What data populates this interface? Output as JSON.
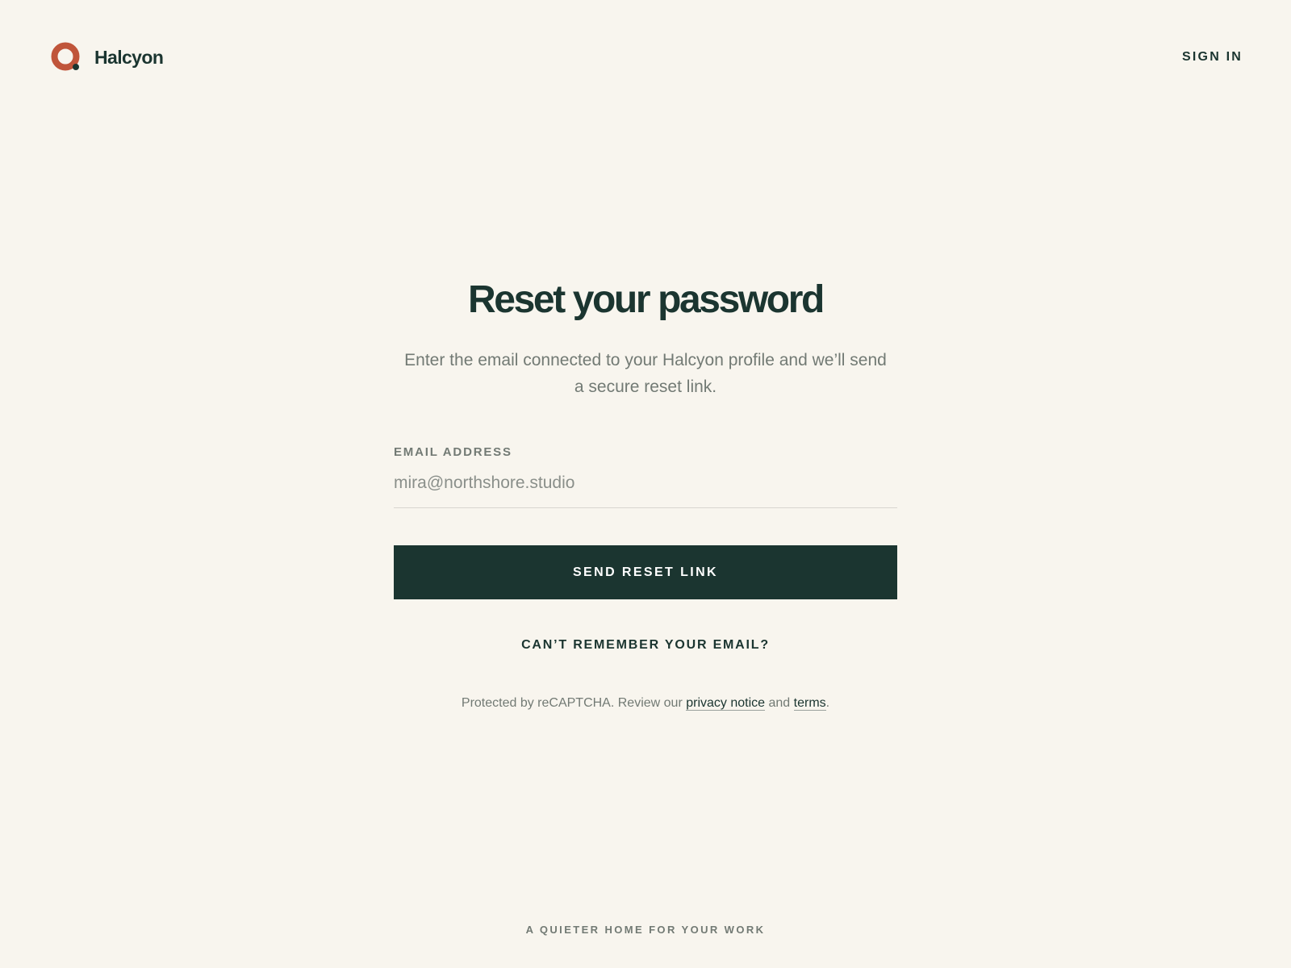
{
  "brand": {
    "name": "Halcyon",
    "logo_icon": "halcyon-ring-logo",
    "logo_color": "#c0553a",
    "logo_dot_color": "#1b3530"
  },
  "header": {
    "signin_label": "SIGN IN"
  },
  "main": {
    "title": "Reset your password",
    "subtitle": "Enter the email connected to your Halcyon profile and we’ll send a secure reset link.",
    "email_label": "EMAIL ADDRESS",
    "email_placeholder": "mira@northshore.studio",
    "email_value": "",
    "submit_label": "SEND RESET LINK",
    "forgot_email_label": "CAN’T REMEMBER YOUR EMAIL?"
  },
  "legal": {
    "prefix": "Protected by reCAPTCHA. Review our",
    "privacy_label": "privacy notice",
    "and_text": "and",
    "terms_label": "terms",
    "suffix": "."
  },
  "footer": {
    "tagline": "A QUIETER HOME FOR YOUR WORK"
  },
  "colors": {
    "background": "#f8f5ee",
    "primary": "#1b3530",
    "accent": "#c0553a",
    "muted_text": "#727a74"
  }
}
